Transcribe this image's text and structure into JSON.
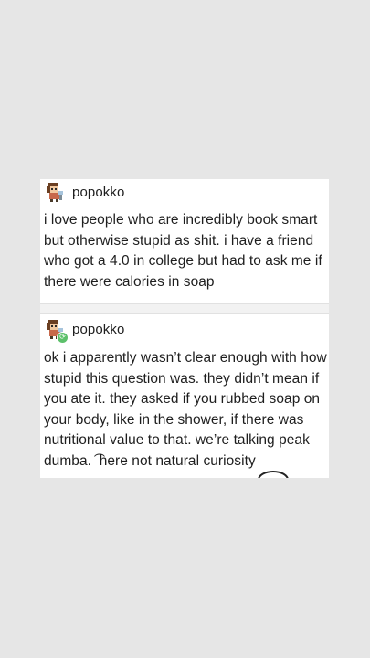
{
  "post_1": {
    "avatar_icon": "pixel-character-avatar-icon",
    "username": "popokko",
    "text": "i love people who are incredibly book smart but otherwise stupid as shit. i have a friend who got a 4.0 in college but had to ask me if there were calories in soap"
  },
  "post_2": {
    "avatar_icon": "pixel-character-avatar-icon",
    "badge_icon": "reblog-icon",
    "username": "popokko",
    "text": "ok i apparently wasn’t clear enough with how stupid this question was. they didn’t mean if you ate it. they asked if you rubbed soap on your body, like in the shower, if there was nutritional value to that. we’re talking peak dumba. ͡ here not natural curiosity"
  },
  "colors": {
    "page_background": "#e6e6e6",
    "card_background": "#ffffff",
    "text": "#1e1e1e",
    "reblog_badge": "#5cc06b"
  }
}
